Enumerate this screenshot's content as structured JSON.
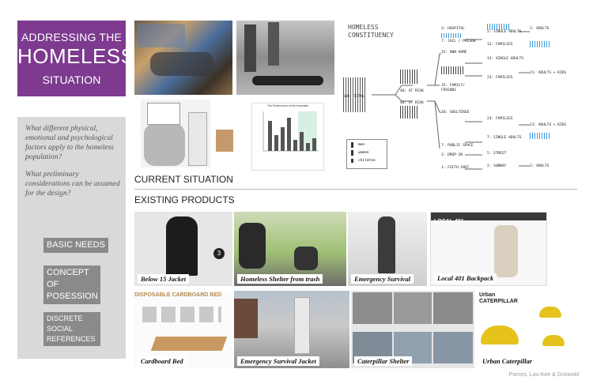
{
  "title": {
    "line1": "ADDRESSING THE",
    "line2": "HOMELESS",
    "line3": "SITUATION"
  },
  "questions": {
    "q1": "What different physical, emotional and psychological factors apply to the homeless population?",
    "q2": "What preliminary considerations can be assumed for the design?"
  },
  "tags": {
    "basic_needs": "BASIC NEEDS",
    "concept_1": "CONCEPT OF",
    "concept_2": "POSESSION",
    "discrete_1": "DISCRETE SOCIAL",
    "discrete_2": "REFERENCES"
  },
  "sections": {
    "current": "CURRENT SITUATION",
    "existing": "EXISTING PRODUCTS"
  },
  "tree": {
    "heading1": "HOMELESS",
    "heading2": "CONSTITUENCY",
    "total": "100: TOTAL",
    "at_risk": "40: AT RISK",
    "at_risk2": "40: AT RISK",
    "hospital": "3: HOSPITAL",
    "jail": "7: JAIL / PRISON",
    "own_home": "15: OWN HOME",
    "family": "35: FAMILY/",
    "friends": "FRIENDS",
    "sheltered": "20: SHELTERED",
    "public_space": "7: PUBLIC SPACE",
    "drop_in": "3: DROP-IN",
    "faith": "1: FAITH INST.",
    "single_1": "2: SINGLE ADULTS",
    "families_1": "12: FAMILIES",
    "single_2": "13: SINGLE ADULTS",
    "families_2": "23: FAMILIES",
    "adults_1": "2: ADULTS",
    "adults_kids_1": "21: ADULTS + KIDS",
    "families_3": "23: FAMILIES",
    "single_3": "7: SINGLE ADULTS",
    "street": "5: STREET",
    "subway": "2: SUBWAY",
    "adults_kids_2": "21: ADULTS + KIDS",
    "adults_2": "2: ADULTS",
    "legend_men": "men",
    "legend_women": "women",
    "legend_children": "children"
  },
  "mini_chart_title": "The Preferences of the Homeless",
  "captions": {
    "c1": "Below 15 Jacket",
    "c2": "Homeless Shelter from trash",
    "c3": "Emergency Survival",
    "c4": "Local 401 Backpack",
    "c5": "Cardboard Bed",
    "c6": "Emergency Survival Jacket",
    "c7": "Caterpillar Shelter",
    "c8": "Urban Caterpillar"
  },
  "product_labels": {
    "disposable": "DISPOSABLE CARDBOARD BED",
    "local401": "LOCAL 401",
    "urban1": "Urban",
    "urban2": "CATERPILLAR"
  },
  "credit": "Parnes, Lau-Kee & Griswold",
  "colors": {
    "purple": "#7d3a8f",
    "panel_grey": "#d9d9d9",
    "tag_grey": "#8a8a8a",
    "icon_blue": "#3a9ad9"
  }
}
